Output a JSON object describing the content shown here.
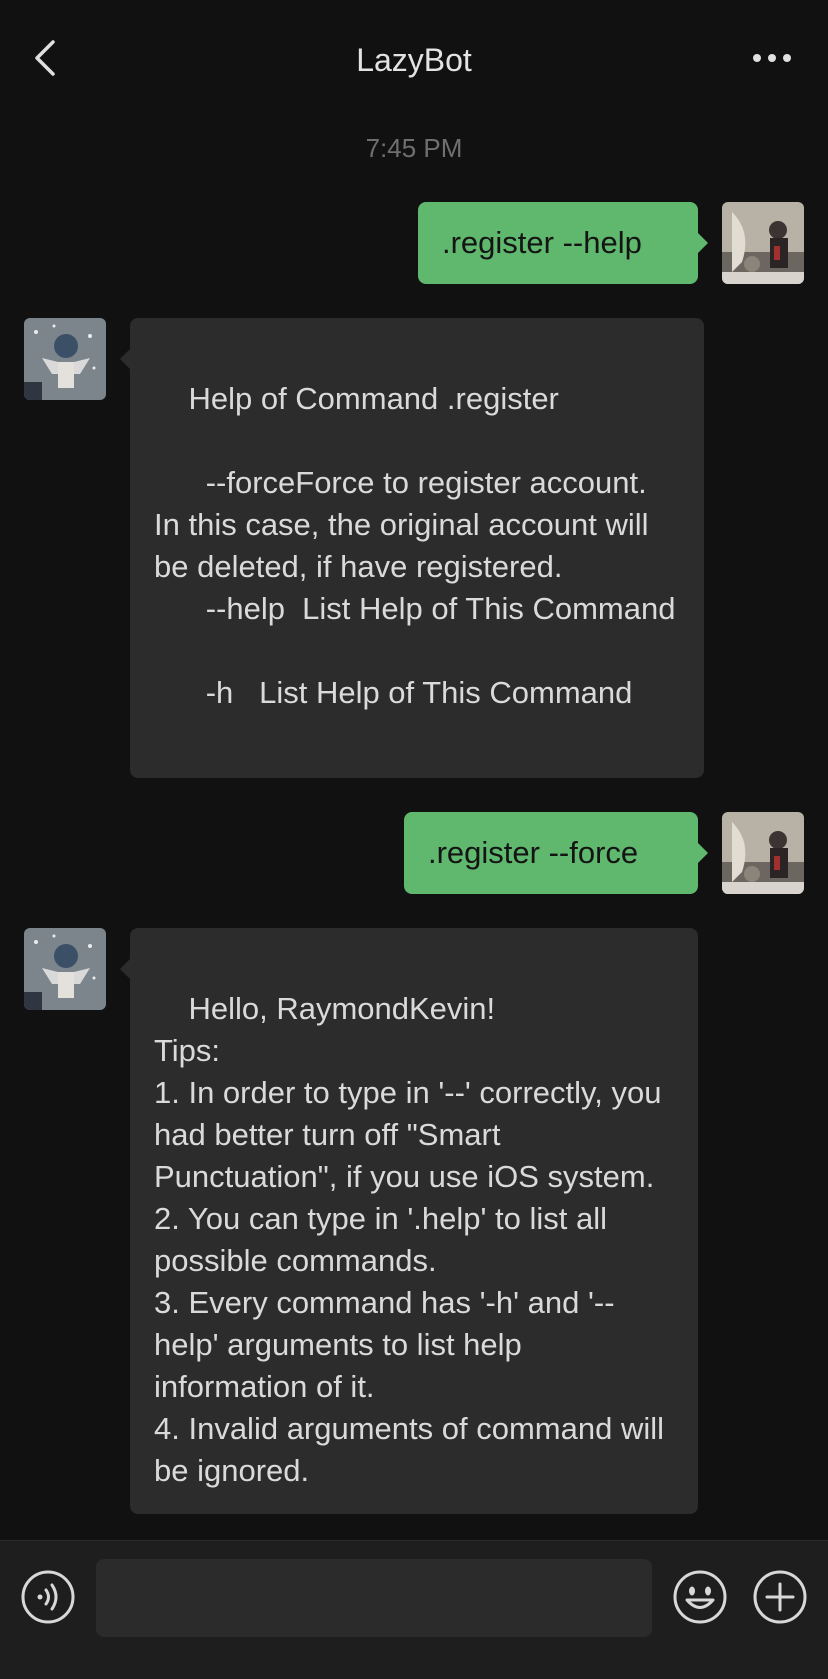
{
  "header": {
    "title": "LazyBot",
    "back_icon": "chevron-left-icon",
    "more_icon": "more-dots-icon"
  },
  "timestamp": "7:45 PM",
  "messages": [
    {
      "direction": "out",
      "text": ".register --help"
    },
    {
      "direction": "in",
      "text": "Help of Command .register\n\n      --forceForce to register account. In this case, the original account will be deleted, if have registered.\n      --help  List Help of This Command\n\n      -h   List Help of This Command"
    },
    {
      "direction": "out",
      "text": ".register --force"
    },
    {
      "direction": "in",
      "text": "Hello, RaymondKevin!\nTips:\n1. In order to type in '--' correctly, you had better turn off \"Smart Punctuation\", if you use iOS system.\n2. You can type in '.help' to list all possible commands.\n3. Every command has '-h' and '--help' arguments to list help information of it.\n4. Invalid arguments of command will be ignored."
    }
  ],
  "input_bar": {
    "voice_icon": "voice-icon",
    "emoji_icon": "emoji-icon",
    "plus_icon": "plus-icon",
    "placeholder": ""
  },
  "colors": {
    "background": "#111111",
    "out_bubble": "#5fb86d",
    "in_bubble": "#2c2c2c",
    "input_bar": "#1e1e1e"
  }
}
